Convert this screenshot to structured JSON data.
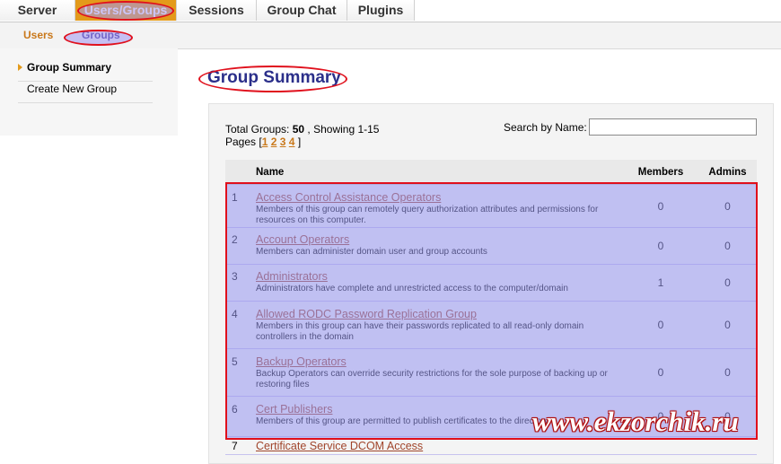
{
  "topnav": {
    "tabs": [
      {
        "label": "Server"
      },
      {
        "label": "Users/Groups"
      },
      {
        "label": "Sessions"
      },
      {
        "label": "Group Chat"
      },
      {
        "label": "Plugins"
      }
    ]
  },
  "subnav": {
    "items": [
      {
        "label": "Users"
      },
      {
        "label": "Groups"
      }
    ]
  },
  "sidebar": {
    "items": [
      {
        "label": "Group Summary"
      },
      {
        "label": "Create New Group"
      }
    ]
  },
  "main": {
    "title": "Group Summary",
    "total_label": "Total Groups:",
    "total_value": "50",
    "showing": ", Showing 1-15",
    "pages_label": "Pages [",
    "pages": [
      "1",
      "2",
      "3",
      "4"
    ],
    "pages_end": "]",
    "search_label": "Search by Name:",
    "search_value": ""
  },
  "table": {
    "headers": {
      "name": "Name",
      "members": "Members",
      "admins": "Admins"
    },
    "rows": [
      {
        "idx": "1",
        "name": "Access Control Assistance Operators",
        "desc": "Members of this group can remotely query authorization attributes and permissions for resources on this computer.",
        "members": "0",
        "admins": "0"
      },
      {
        "idx": "2",
        "name": "Account Operators",
        "desc": "Members can administer domain user and group accounts",
        "members": "0",
        "admins": "0"
      },
      {
        "idx": "3",
        "name": "Administrators",
        "desc": "Administrators have complete and unrestricted access to the computer/domain",
        "members": "1",
        "admins": "0"
      },
      {
        "idx": "4",
        "name": "Allowed RODC Password Replication Group",
        "desc": "Members in this group can have their passwords replicated to all read-only domain controllers in the domain",
        "members": "0",
        "admins": "0"
      },
      {
        "idx": "5",
        "name": "Backup Operators",
        "desc": "Backup Operators can override security restrictions for the sole purpose of backing up or restoring files",
        "members": "0",
        "admins": "0"
      },
      {
        "idx": "6",
        "name": "Cert Publishers",
        "desc": "Members of this group are permitted to publish certificates to the directory",
        "members": "0",
        "admins": "0"
      },
      {
        "idx": "7",
        "name": "Certificate Service DCOM Access",
        "desc": "",
        "members": "",
        "admins": ""
      }
    ]
  },
  "watermark": "www.ekzorchik.ru",
  "colors": {
    "accent": "#e39a1b",
    "highlight_ring": "#e0101c",
    "title": "#2b2f8a",
    "link": "#a0452b"
  }
}
